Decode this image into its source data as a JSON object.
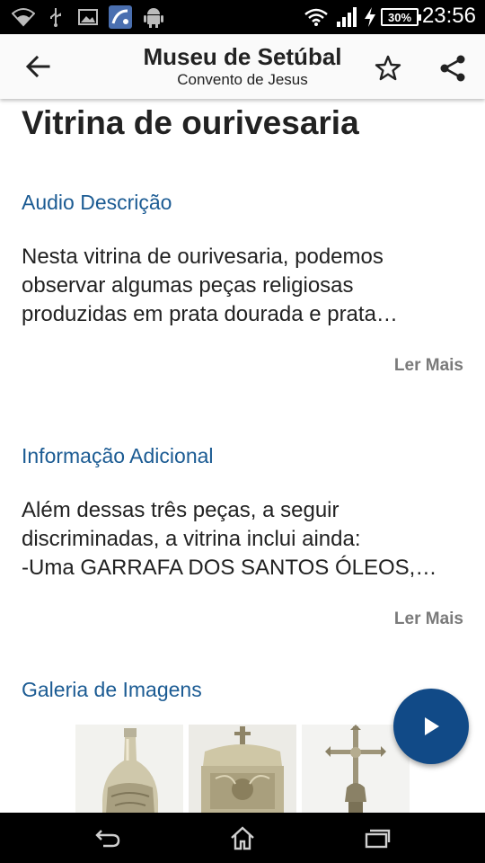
{
  "status_bar": {
    "time": "23:56",
    "battery": "30%",
    "icons": [
      "wifi-icon",
      "usb-icon",
      "image-icon",
      "app-icon",
      "android-icon",
      "wifi-signal-icon",
      "cell-signal-icon",
      "charging-icon",
      "battery-icon"
    ]
  },
  "app_bar": {
    "title": "Museu de Setúbal",
    "subtitle": "Convento de Jesus",
    "icons": [
      "back-arrow-icon",
      "star-icon",
      "share-icon"
    ]
  },
  "page": {
    "title": "Vitrina de ourivesaria"
  },
  "audio_section": {
    "heading": "Audio Descrição",
    "lines": [
      "Nesta vitrina de ourivesaria, podemos",
      "observar algumas peças religiosas",
      "produzidas em  prata dourada e prata…"
    ],
    "read_more": "Ler Mais"
  },
  "info_section": {
    "heading": "Informação Adicional",
    "lines": [
      "Além dessas três peças, a seguir",
      "discriminadas, a vitrina inclui ainda:",
      "-Uma GARRAFA DOS SANTOS ÓLEOS,…"
    ],
    "read_more": "Ler Mais"
  },
  "gallery": {
    "heading": "Galeria de Imagens",
    "images": [
      "silver-bottle",
      "silver-casket",
      "processional-cross"
    ]
  },
  "fab": {
    "icon": "play-icon",
    "color": "#114a87"
  },
  "nav_bar": {
    "icons": [
      "back-nav-icon",
      "home-nav-icon",
      "recents-nav-icon"
    ]
  },
  "colors": {
    "accent": "#1b5b93",
    "text": "#222222",
    "muted": "#7a7a7a"
  }
}
